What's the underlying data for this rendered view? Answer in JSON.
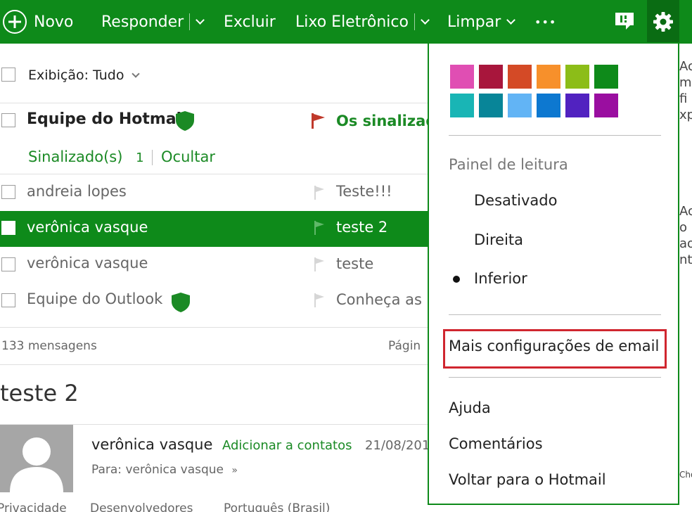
{
  "toolbar": {
    "new_label": "Novo",
    "reply_label": "Responder",
    "delete_label": "Excluir",
    "junk_label": "Lixo Eletrônico",
    "sweep_label": "Limpar",
    "more_label": "•••"
  },
  "list": {
    "view_label": "Exibição: Tudo",
    "flagged_sender": "Equipe do Hotmail",
    "flagged_subject": "Os sinalizado",
    "flagged_count_label": "Sinalizado(s)",
    "flagged_count": "1",
    "hide_label": "Ocultar",
    "rows": [
      {
        "sender": "andreia lopes",
        "subject": "Teste!!!"
      },
      {
        "sender": "verônica vasque",
        "subject": "teste 2"
      },
      {
        "sender": "verônica vasque",
        "subject": "teste"
      },
      {
        "sender": "Equipe do Outlook",
        "subject": "Conheça as"
      }
    ],
    "message_count": "133 mensagens",
    "page_label": "Págin"
  },
  "reading": {
    "subject": "teste 2",
    "sender": "verônica vasque",
    "add_contact": "Adicionar a contatos",
    "date": "21/08/201",
    "to_label": "Para: verônica vasque"
  },
  "footer": {
    "privacy": "Privacidade",
    "developers": "Desenvolvedores",
    "language": "Português (Brasil)"
  },
  "menu": {
    "reading_pane_label": "Painel de leitura",
    "off_label": "Desativado",
    "right_label": "Direita",
    "bottom_label": "Inferior",
    "more_settings_label": "Mais configurações de email",
    "help_label": "Ajuda",
    "feedback_label": "Comentários",
    "back_label": "Voltar para o Hotmail",
    "swatches": [
      "#e04eb3",
      "#a8163c",
      "#d44a26",
      "#f7902b",
      "#8cbd18",
      "#0e8a1a",
      "#19b5b5",
      "#088598",
      "#62b4f5",
      "#0d78d0",
      "#5122c0",
      "#9a0ea0"
    ]
  },
  "peek": {
    "lines_top": [
      "Ac",
      "m",
      "fi",
      "xp"
    ],
    "lines_mid": [
      "Ac",
      "o",
      "ao",
      "nt"
    ],
    "footer_peek": "Cho"
  },
  "colors": {
    "brand_green": "#0e8a1a",
    "highlight_red": "#d0262f",
    "flag_red": "#c0392b"
  }
}
